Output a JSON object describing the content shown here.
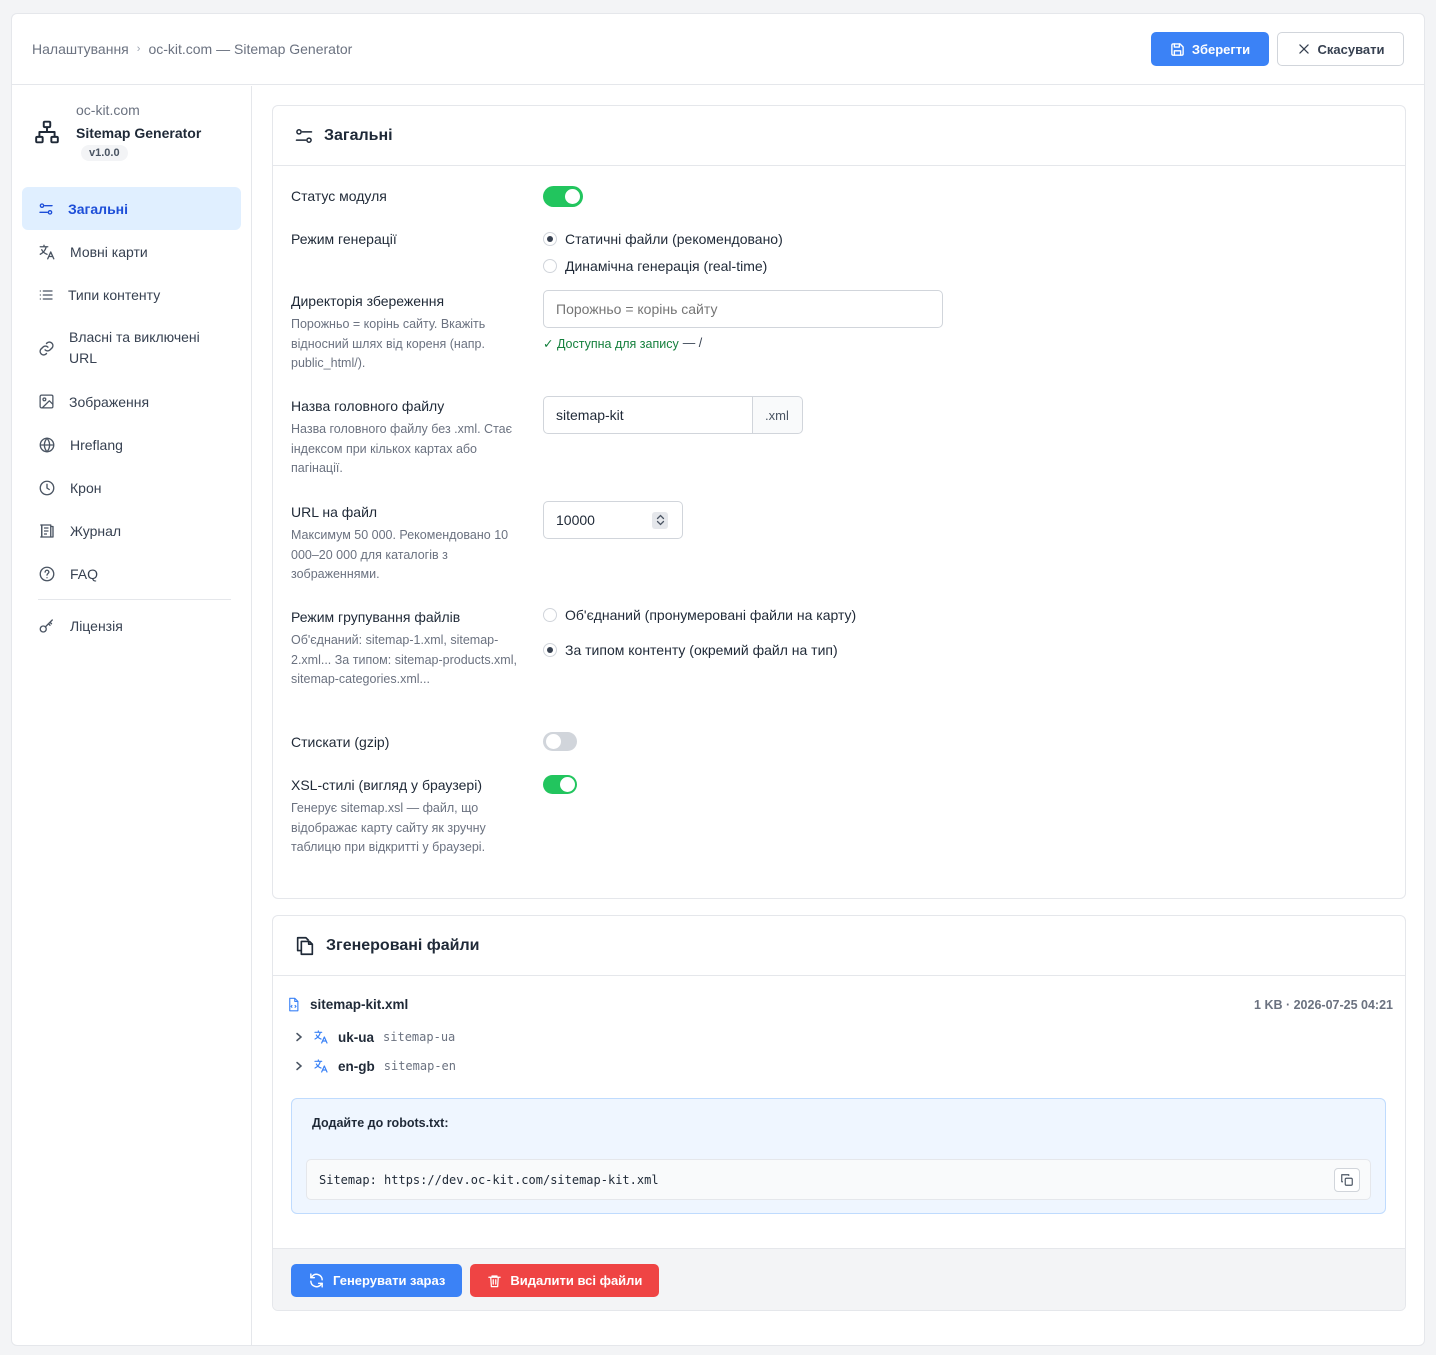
{
  "breadcrumb": {
    "root": "Налаштування",
    "current": "oc-kit.com — Sitemap Generator"
  },
  "toolbar": {
    "save_label": "Зберегти",
    "cancel_label": "Скасувати"
  },
  "brand": {
    "site": "oc-kit.com",
    "name": "Sitemap Generator",
    "version": "v1.0.0"
  },
  "sidebar": {
    "items": [
      {
        "label": "Загальні",
        "icon": "sliders-icon",
        "active": true
      },
      {
        "label": "Мовні карти",
        "icon": "translate-icon"
      },
      {
        "label": "Типи контенту",
        "icon": "list-icon"
      },
      {
        "label": "Власні та виключені URL",
        "icon": "link-icon"
      },
      {
        "label": "Зображення",
        "icon": "image-icon"
      },
      {
        "label": "Hreflang",
        "icon": "globe-icon"
      },
      {
        "label": "Крон",
        "icon": "clock-icon"
      },
      {
        "label": "Журнал",
        "icon": "journal-icon"
      },
      {
        "label": "FAQ",
        "icon": "question-icon"
      },
      {
        "label": "Ліцензія",
        "icon": "key-icon"
      }
    ]
  },
  "general": {
    "title": "Загальні",
    "status": {
      "label": "Статус модуля",
      "enabled": true
    },
    "mode": {
      "label": "Режим генерації",
      "options": [
        "Статичні файли (рекомендовано)",
        "Динамічна генерація (real-time)"
      ],
      "selected": 0
    },
    "dir": {
      "label": "Директорія збереження",
      "hint": "Порожньо = корінь сайту. Вкажіть відносний шлях від кореня (напр. public_html/).",
      "placeholder": "Порожньо = корінь сайту",
      "status": "✓ Доступна для запису",
      "status_suffix": "— /"
    },
    "filename": {
      "label": "Назва головного файлу",
      "hint": "Назва головного файлу без .xml. Стає індексом при кількох картах або пагінації.",
      "value": "sitemap-kit",
      "suffix": ".xml"
    },
    "urls": {
      "label": "URL на файл",
      "hint": "Максимум 50 000. Рекомендовано 10 000–20 000 для каталогів з зображеннями.",
      "value": "10000"
    },
    "grouping": {
      "label": "Режим групування файлів",
      "hint": "Об'єднаний: sitemap-1.xml, sitemap-2.xml... За типом: sitemap-products.xml, sitemap-categories.xml...",
      "options": [
        "Об'єднаний (пронумеровані файли на карту)",
        "За типом контенту (окремий файл на тип)"
      ],
      "selected": 1
    },
    "gzip": {
      "label": "Стискати (gzip)",
      "enabled": false
    },
    "xsl": {
      "label": "XSL-стилі (вигляд у браузері)",
      "hint": "Генерує sitemap.xsl — файл, що відображає карту сайту як зручну таблицю при відкритті у браузері.",
      "enabled": true
    }
  },
  "files": {
    "title": "Згенеровані файли",
    "main": {
      "name": "sitemap-kit.xml",
      "meta": "1 KB · 2026-07-25 04:21"
    },
    "langs": [
      {
        "code": "uk-ua",
        "file": "sitemap-ua"
      },
      {
        "code": "en-gb",
        "file": "sitemap-en"
      }
    ],
    "robots": {
      "label": "Додайте до robots.txt:",
      "line": "Sitemap: https://dev.oc-kit.com/sitemap-kit.xml"
    },
    "generate_label": "Генерувати зараз",
    "delete_label": "Видалити всі файли"
  },
  "colors": {
    "accent": "#3b82f6",
    "success": "#22c55e",
    "danger": "#ef4444",
    "active_bg": "#e0efff"
  }
}
